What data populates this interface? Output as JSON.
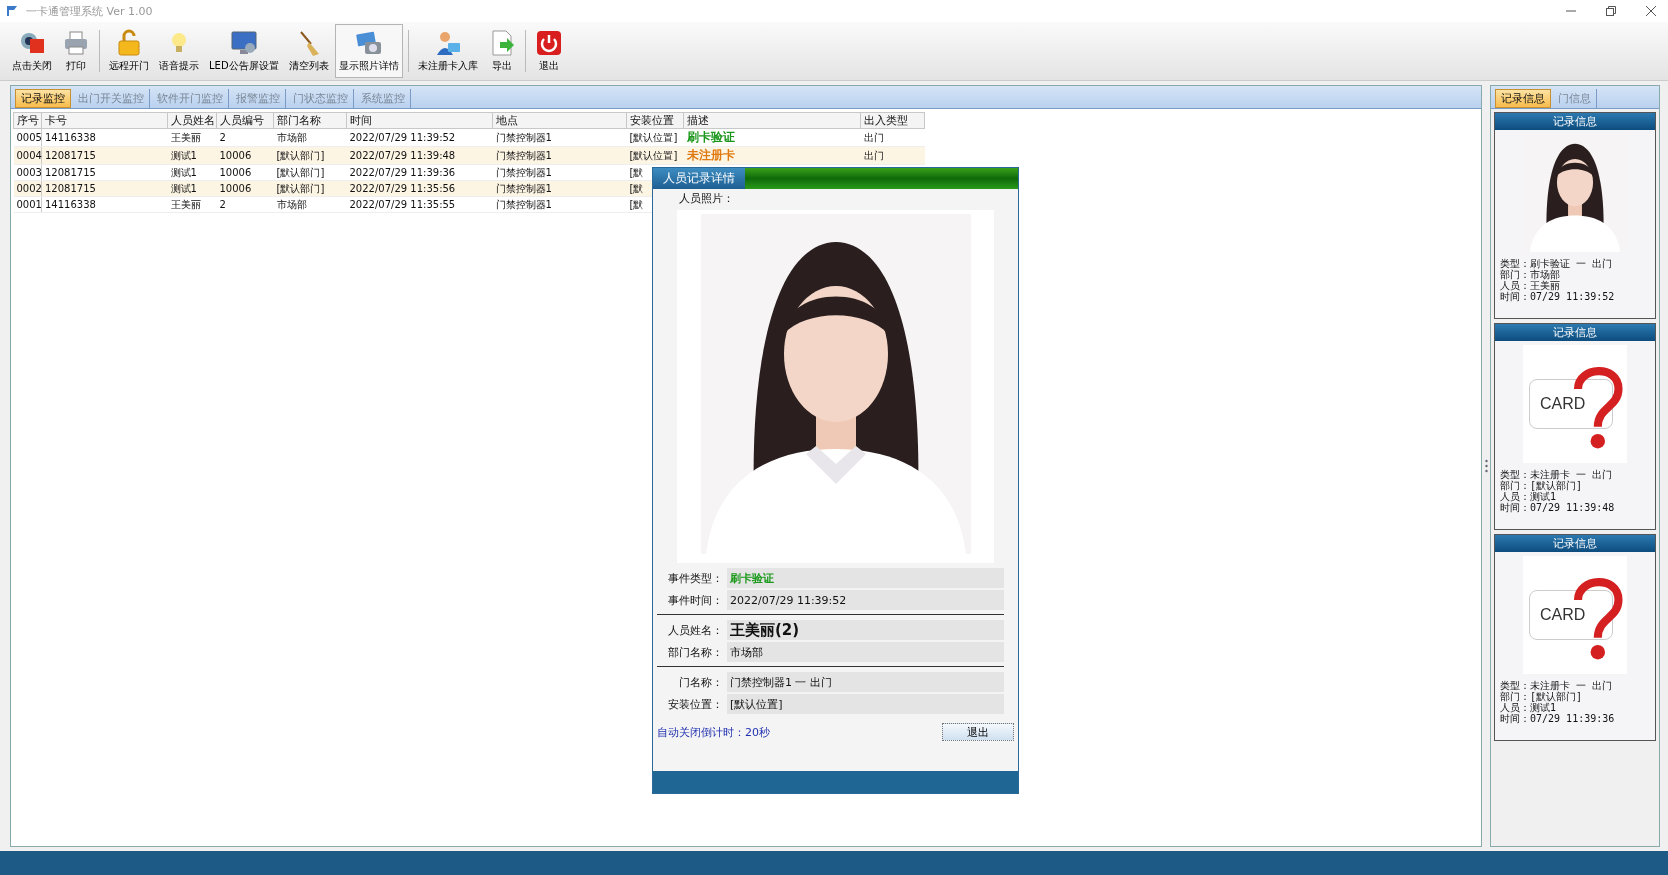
{
  "window": {
    "title": "一卡通管理系统  Ver 1.00"
  },
  "toolbar": {
    "groups": [
      [
        {
          "label": "点击关闭",
          "pressed": false
        },
        {
          "label": "打印",
          "pressed": false
        }
      ],
      [
        {
          "label": "远程开门",
          "pressed": false
        },
        {
          "label": "语音提示",
          "pressed": false
        },
        {
          "label": "LED公告屏设置",
          "pressed": false
        },
        {
          "label": "清空列表",
          "pressed": false
        },
        {
          "label": "显示照片详情",
          "pressed": true
        }
      ],
      [
        {
          "label": "未注册卡入库",
          "pressed": false
        },
        {
          "label": "导出",
          "pressed": false
        }
      ],
      [
        {
          "label": "退出",
          "pressed": false
        }
      ]
    ]
  },
  "tabs": [
    {
      "label": "记录监控",
      "selected": true
    },
    {
      "label": "出门开关监控",
      "selected": false
    },
    {
      "label": "软件开门监控",
      "selected": false
    },
    {
      "label": "报警监控",
      "selected": false
    },
    {
      "label": "门状态监控",
      "selected": false
    },
    {
      "label": "系统监控",
      "selected": false
    }
  ],
  "table": {
    "columns": [
      "序号",
      "卡号",
      "人员姓名",
      "人员编号",
      "部门名称",
      "时间",
      "地点",
      "安装位置",
      "描述",
      "出入类型"
    ],
    "rows": [
      {
        "cells": [
          "0005",
          "14116338",
          "王美丽",
          "2",
          "市场部",
          "2022/07/29 11:39:52",
          "门禁控制器1",
          "[默认位置]",
          "刷卡验证",
          "出门"
        ],
        "color": "#1a961a"
      },
      {
        "cells": [
          "0004",
          "12081715",
          "测试1",
          "10006",
          "[默认部门]",
          "2022/07/29 11:39:48",
          "门禁控制器1",
          "[默认位置]",
          "未注册卡",
          "出门"
        ],
        "color": "#e07a10"
      },
      {
        "cells": [
          "0003",
          "12081715",
          "测试1",
          "10006",
          "[默认部门]",
          "2022/07/29 11:39:36",
          "门禁控制器1",
          "[默"
        ]
      },
      {
        "cells": [
          "0002",
          "12081715",
          "测试1",
          "10006",
          "[默认部门]",
          "2022/07/29 11:35:56",
          "门禁控制器1",
          "[默"
        ]
      },
      {
        "cells": [
          "0001",
          "14116338",
          "王美丽",
          "2",
          "市场部",
          "2022/07/29 11:35:55",
          "门禁控制器1",
          "[默"
        ]
      }
    ]
  },
  "dialog": {
    "title": "人员记录详情",
    "photo_label": "人员照片：",
    "photo": {
      "kind": "picture"
    },
    "field_groups": [
      [
        {
          "label": "事件类型：",
          "value": "刷卡验证",
          "color": "#1c9a1c",
          "kind": "normal"
        },
        {
          "label": "事件时间：",
          "value": "2022/07/29 11:39:52",
          "kind": "normal"
        }
      ],
      [
        {
          "label": "人员姓名：",
          "value": "王美丽(2)",
          "kind": "large"
        },
        {
          "label": "部门名称：",
          "value": "市场部",
          "kind": "normal"
        }
      ],
      [
        {
          "label": "门名称：",
          "value": "门禁控制器1 一 出门",
          "kind": "normal"
        },
        {
          "label": "安装位置：",
          "value": "[默认位置]",
          "kind": "normal"
        }
      ]
    ],
    "countdown": "自动关闭倒计时：20秒",
    "close_button": "退出"
  },
  "side_panel": {
    "tabs": [
      {
        "label": "记录信息",
        "selected": true
      },
      {
        "label": "门信息",
        "selected": false
      }
    ],
    "cards": [
      {
        "title": "记录信息",
        "kind": "picture",
        "lines": [
          "类型：刷卡验证 一 出门",
          "部门：市场部",
          "人员：王美丽",
          "时间：07/29 11:39:52"
        ]
      },
      {
        "title": "记录信息",
        "kind": "unknown_card",
        "card_text": "CARD",
        "lines": [
          "类型：未注册卡 一 出门",
          "部门：[默认部门]",
          "人员：测试1",
          "时间：07/29 11:39:48"
        ]
      },
      {
        "title": "记录信息",
        "kind": "unknown_card",
        "card_text": "CARD",
        "lines": [
          "类型：未注册卡 一 出门",
          "部门：[默认部门]",
          "人员：测试1",
          "时间：07/29 11:39:36"
        ]
      }
    ]
  }
}
